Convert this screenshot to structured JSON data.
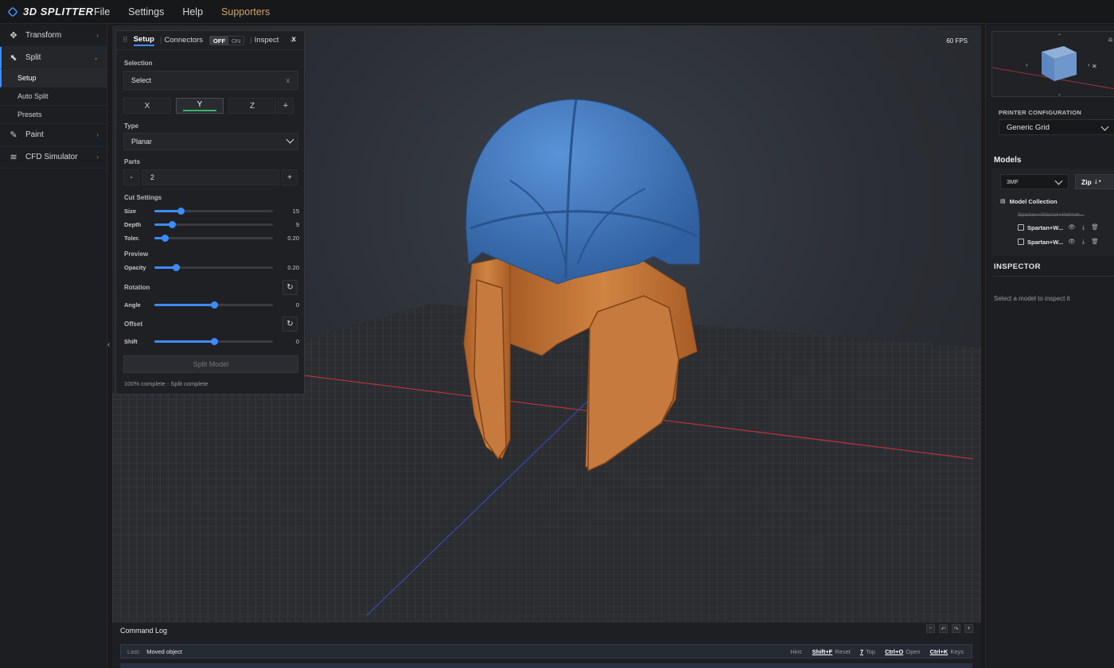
{
  "app": {
    "logo_text": "3D SPLITTER",
    "menu": [
      "File",
      "Settings",
      "Help",
      "Supporters"
    ],
    "accent_color": "#3d8cff"
  },
  "sidebar": {
    "items": [
      {
        "label": "Transform",
        "icon": "move-icon",
        "chevron": "›"
      },
      {
        "label": "Split",
        "icon": "cursor-select-icon",
        "chevron": "⌄"
      },
      {
        "label": "Paint",
        "icon": "brush-icon",
        "chevron": "›"
      },
      {
        "label": "CFD Simulator",
        "icon": "wind-icon",
        "chevron": "›"
      }
    ],
    "split_subitems": [
      "Setup",
      "Auto Split",
      "Presets"
    ]
  },
  "viewport": {
    "fps": "60 FPS",
    "collapse_glyph": "‹"
  },
  "split_panel": {
    "tabs": {
      "setup": "Setup",
      "connectors": "Connectors",
      "inspect": "Inspect"
    },
    "toggle": {
      "off": "OFF",
      "on": "ON"
    },
    "close": "x",
    "selection_label": "Selection",
    "selection_value": "Select",
    "selection_clear": "x",
    "axes": [
      "X",
      "Y",
      "Z"
    ],
    "axis_selected": "Y",
    "axis_add": "+",
    "type_label": "Type",
    "type_value": "Planar",
    "parts_label": "Parts",
    "parts_minus": "-",
    "parts_value": "2",
    "parts_plus": "+",
    "cut_settings_label": "Cut Settings",
    "cut_sliders": [
      {
        "label": "Size",
        "value": "15",
        "fraction": 0.22
      },
      {
        "label": "Depth",
        "value": "9",
        "fraction": 0.15
      },
      {
        "label": "Toler.",
        "value": "0.20",
        "fraction": 0.09
      }
    ],
    "preview_label": "Preview",
    "preview_sliders": [
      {
        "label": "Opacity",
        "value": "0.20",
        "fraction": 0.18
      }
    ],
    "rotation_label": "Rotation",
    "rotation_sliders": [
      {
        "label": "Angle",
        "value": "0",
        "fraction": 0.5
      }
    ],
    "offset_label": "Offset",
    "offset_sliders": [
      {
        "label": "Shift",
        "value": "0",
        "fraction": 0.5
      }
    ],
    "reset_glyph": "↻",
    "split_button": "Split Model",
    "status": "100% complete - Split complete"
  },
  "right_panel": {
    "printer_config_label": "PRINTER CONFIGURATION",
    "printer_value": "Generic Grid",
    "models_title": "Models",
    "format_value": "3MF",
    "zip_label": "Zip",
    "zip_icons": "⤓ ▾",
    "collection_label": "Model Collection",
    "source_model": "Spartan+Warrior+Helmet...",
    "models": [
      "Spartan+W...",
      "Spartan+W..."
    ],
    "row_icons": "👁 ⤓ 🗑",
    "inspector_title": "INSPECTOR",
    "inspector_hint": "Select a model to inspect it"
  },
  "command_log": {
    "title": "Command Log",
    "controls": [
      "−",
      "↶",
      "↷",
      "+"
    ],
    "last_label": "Last:",
    "last_value": "Moved object",
    "hint_label": "Hint:",
    "hints": [
      {
        "key": "Shift+F",
        "action": "Reset"
      },
      {
        "key": "7",
        "action": "Top"
      },
      {
        "key": "Ctrl+O",
        "action": "Open"
      },
      {
        "key": "Ctrl+K",
        "action": "Keys"
      }
    ]
  },
  "colors": {
    "helmet_top": "#3e78c2",
    "helmet_bottom": "#c87a3c",
    "x_axis": "#d0363a",
    "y_axis": "#3a4cd6"
  }
}
